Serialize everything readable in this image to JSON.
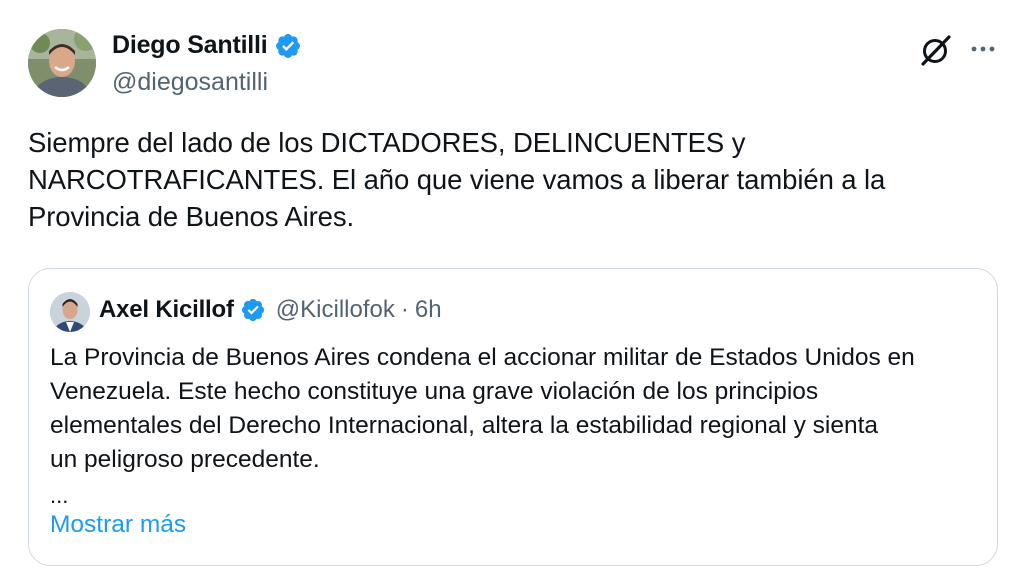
{
  "tweet": {
    "author": {
      "name": "Diego Santilli",
      "handle": "@diegosantilli",
      "verified": true
    },
    "text_lines": [
      "Siempre del lado de los DICTADORES, DELINCUENTES y",
      "NARCOTRAFICANTES. El año que viene vamos a liberar también a la",
      "Provincia de Buenos Aires."
    ],
    "icons": {
      "grok": "grok-icon",
      "more": "more-options-icon",
      "verified": "verified-badge-icon"
    },
    "colors": {
      "verified_blue": "#1d9bf0",
      "link_blue": "#1d9bf0",
      "secondary_text": "#536471",
      "border": "#cfd9de"
    }
  },
  "quote": {
    "author": {
      "name": "Axel Kicillof",
      "handle": "@Kicillofok",
      "separator": "·",
      "time": "6h",
      "verified": true
    },
    "text_lines": [
      "La Provincia de Buenos Aires condena el accionar militar de Estados Unidos en",
      "Venezuela. Este hecho constituye una grave violación de los principios",
      "elementales del Derecho Internacional, altera la estabilidad regional y sienta",
      "un peligroso precedente."
    ],
    "ellipsis": "...",
    "show_more": "Mostrar más"
  }
}
